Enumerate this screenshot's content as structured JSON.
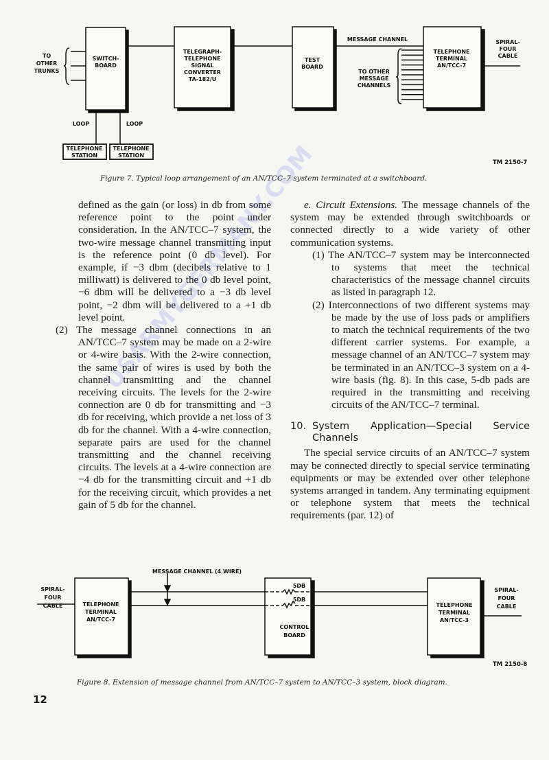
{
  "figure7": {
    "boxes": {
      "switchboard": "SWITCH-|BOARD",
      "converter": "TELEGRAPH-|TELEPHONE|SIGNAL|CONVERTER|TA-182/U",
      "test_board": "TEST|BOARD",
      "terminal": "TELEPHONE|TERMINAL|AN/TCC-7",
      "station1": "TELEPHONE|STATION",
      "station2": "TELEPHONE|STATION"
    },
    "labels": {
      "other_trunks": "TO|OTHER|TRUNKS",
      "loop1": "LOOP",
      "loop2": "LOOP",
      "message_channel": "MESSAGE CHANNEL",
      "other_channels": "TO OTHER|MESSAGE|CHANNELS",
      "cable": "SPIRAL-|FOUR|CABLE"
    },
    "ref": "TM 2150-7",
    "caption": "Figure 7.   Typical loop arrangement of an AN/TCC–7 system terminated at a switchboard."
  },
  "left_column": {
    "para1": "defined as the gain (or loss) in db from some reference point to the point under consideration. In the AN/TCC–7 system, the two-wire message channel transmitting input is the reference point (0 db level). For example, if −3 dbm (decibels relative to 1 milliwatt) is delivered to the 0 db level point, −6 dbm will be delivered to a −3 db level point, −2 dbm will be delivered to a +1 db level point.",
    "para2": "(2) The message channel connections in an AN/TCC–7 system may be made on a 2-wire or 4-wire basis. With the 2-wire connection, the same pair of wires is used by both the channel transmitting and the channel receiving circuits. The levels for the 2-wire connection are 0 db for transmitting and −3 db for receiving, which provide a net loss of 3 db for the channel. With a 4-wire connection, separate pairs are used for the channel transmitting and the channel receiving circuits. The levels at a 4-wire connection are −4 db for the transmitting circuit and +1 db for the receiving circuit, which provides a net gain of 5 db for the channel."
  },
  "right_column": {
    "e_label": "e. Circuit Extensions.",
    "e_text": " The message channels of the system may be extended through switchboards or connected directly to a wide variety of other communication systems.",
    "item1": "(1) The AN/TCC–7 system may be interconnected to systems that meet the technical characteristics of the message channel circuits as listed in paragraph 12.",
    "item2": "(2) Interconnections of two different systems may be made by the use of loss pads or amplifiers to match the technical requirements of the two different carrier systems. For example, a message channel of an AN/TCC–7 system may be terminated in an AN/TCC–3 system on a 4-wire basis (fig. 8). In this case, 5-db pads are required in the transmitting and receiving circuits of the AN/TCC–7 terminal.",
    "heading_num": "10.",
    "heading_text": "System Application—Special Service Channels",
    "para10": "The special service circuits of an AN/TCC–7 system may be connected directly to special service terminating equipments or may be extended over other telephone systems arranged in tandem. Any terminating equipment or telephone system that meets the technical requirements (par. 12) of"
  },
  "figure8": {
    "boxes": {
      "terminal7": "TELEPHONE|TERMINAL|AN/TCC-7",
      "control": "CONTROL|BOARD",
      "terminal3": "TELEPHONE|TERMINAL|AN/TCC-3"
    },
    "labels": {
      "cable_left": "SPIRAL-|FOUR|CABLE",
      "cable_right": "SPIRAL-|FOUR|CABLE",
      "message_channel": "MESSAGE CHANNEL (4 WIRE)",
      "pad1": "5DB",
      "pad2": "5DB"
    },
    "ref": "TM 2150-8",
    "caption": "Figure 8.   Extension of message channel from AN/TCC–7 system to AN/TCC–3 system, block diagram."
  },
  "page_number": "12",
  "watermark": "USARMYGERMANY.COM"
}
